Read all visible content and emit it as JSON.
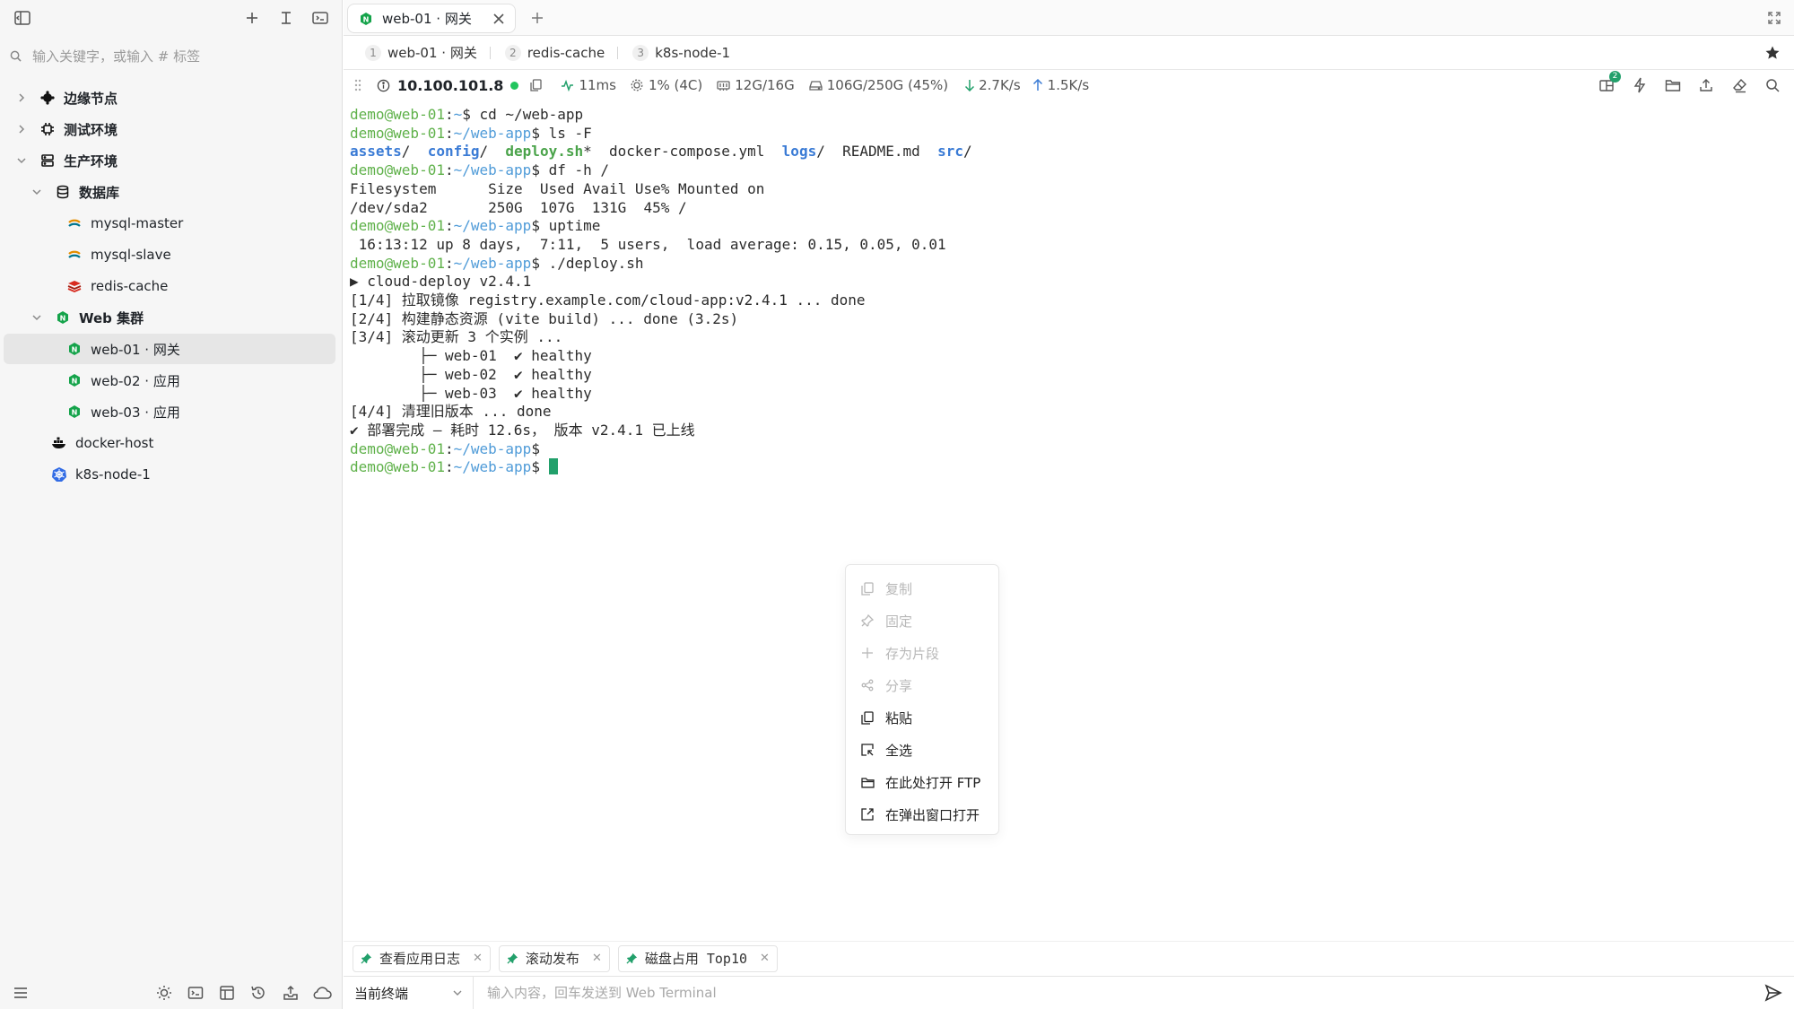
{
  "sidebar": {
    "search_placeholder": "输入关键字，或输入 # 标签",
    "tree": [
      {
        "label": "边缘节点",
        "icon": "gear-node-icon"
      },
      {
        "label": "测试环境",
        "icon": "chip-icon"
      },
      {
        "label": "生产环境",
        "icon": "server-icon"
      },
      {
        "label": "数据库",
        "icon": "database-icon"
      },
      {
        "label": "mysql-master",
        "icon": "mysql-icon"
      },
      {
        "label": "mysql-slave",
        "icon": "mysql-icon"
      },
      {
        "label": "redis-cache",
        "icon": "redis-icon"
      },
      {
        "label": "Web 集群",
        "icon": "nginx-icon"
      },
      {
        "label": "web-01 · 网关",
        "icon": "nginx-icon"
      },
      {
        "label": "web-02 · 应用",
        "icon": "nginx-icon"
      },
      {
        "label": "web-03 · 应用",
        "icon": "nginx-icon"
      },
      {
        "label": "docker-host",
        "icon": "docker-icon"
      },
      {
        "label": "k8s-node-1",
        "icon": "kubernetes-icon"
      }
    ]
  },
  "tabs": {
    "active_label": "web-01 · 网关"
  },
  "window_tabs": [
    {
      "num": "1",
      "label": "web-01 · 网关"
    },
    {
      "num": "2",
      "label": "redis-cache"
    },
    {
      "num": "3",
      "label": "k8s-node-1"
    }
  ],
  "status": {
    "ip": "10.100.101.8",
    "latency": "11ms",
    "cpu": "1% (4C)",
    "memory": "12G/16G",
    "disk": "106G/250G (45%)",
    "download": "2.7K/s",
    "upload": "1.5K/s",
    "notifications_badge": "2"
  },
  "terminal": {
    "prompt_user": "demo@web-01",
    "lines": [
      {
        "path": "~",
        "cmd": " cd ~/web-app"
      },
      {
        "path": "~/web-app",
        "cmd": " ls -F"
      },
      {
        "out": "Filesystem      Size  Used Avail Use% Mounted on"
      },
      {
        "out": "/dev/sda2       250G  107G  131G  45% /"
      },
      {
        "path": "~/web-app",
        "cmd": " uptime"
      },
      {
        "out": " 16:13:12 up 8 days,  7:11,  5 users,  load average: 0.15, 0.05, 0.01"
      },
      {
        "path": "~/web-app",
        "cmd": " ./deploy.sh"
      },
      {
        "out": "▶ cloud-deploy v2.4.1"
      },
      {
        "out": "[1/4] 拉取镜像 registry.example.com/cloud-app:v2.4.1 ... done"
      },
      {
        "out": "[2/4] 构建静态资源 (vite build) ... done (3.2s)"
      },
      {
        "out": "[3/4] 滚动更新 3 个实例 ..."
      },
      {
        "out": "        ├─ web-01  ✔ healthy"
      },
      {
        "out": "        ├─ web-02  ✔ healthy"
      },
      {
        "out": "        ├─ web-03  ✔ healthy"
      },
      {
        "out": "[4/4] 清理旧版本 ... done"
      },
      {
        "out": "✔ 部署完成 — 耗时 12.6s， 版本 v2.4.1 已上线"
      }
    ],
    "ls_output": {
      "assets": "assets",
      "config": "config",
      "deploy": "deploy.sh",
      "compose": "docker-compose.yml",
      "logs": "logs",
      "readme": "README.md",
      "src": "src"
    },
    "df_cmd": " df -h /"
  },
  "context_menu": [
    {
      "label": "复制",
      "enabled": false,
      "icon": "copy-icon"
    },
    {
      "label": "固定",
      "enabled": false,
      "icon": "pin-icon"
    },
    {
      "label": "存为片段",
      "enabled": false,
      "icon": "plus-icon"
    },
    {
      "label": "分享",
      "enabled": false,
      "icon": "share-icon"
    },
    {
      "label": "粘贴",
      "enabled": true,
      "icon": "paste-icon"
    },
    {
      "label": "全选",
      "enabled": true,
      "icon": "select-all-icon"
    },
    {
      "label": "在此处打开 FTP",
      "enabled": true,
      "icon": "folder-icon"
    },
    {
      "label": "在弹出窗口打开",
      "enabled": true,
      "icon": "external-icon"
    }
  ],
  "snippets": [
    {
      "label": "查看应用日志"
    },
    {
      "label": "滚动发布"
    },
    {
      "label": "磁盘占用 Top10"
    }
  ],
  "input_bar": {
    "target": "当前终端",
    "placeholder": "输入内容，回车发送到 Web Terminal"
  },
  "colors": {
    "accent": "#22a06b",
    "prompt_user": "#5fb14a",
    "prompt_path": "#4f9bd8"
  }
}
